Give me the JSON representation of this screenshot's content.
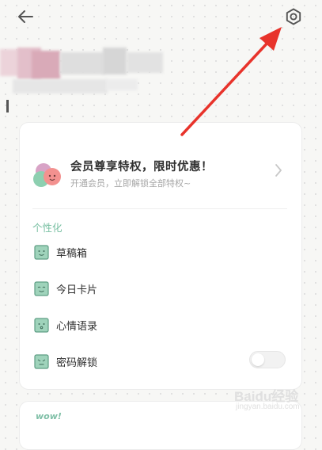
{
  "colors": {
    "accent": "#78bfa2",
    "annotation_arrow": "#e8332b",
    "icon_fill": "#9fd3bb",
    "icon_stroke": "#5e9e84"
  },
  "header": {
    "back_icon": "arrow-left-icon",
    "settings_icon": "gear-icon"
  },
  "membership": {
    "title": "会员尊享特权，限时优惠！",
    "subtitle": "开通会员，立即解锁全部特权~",
    "chevron_icon": "chevron-right-icon"
  },
  "personalization": {
    "section_title": "个性化",
    "items": [
      {
        "label": "草稿箱",
        "icon": "face-icon"
      },
      {
        "label": "今日卡片",
        "icon": "face-icon"
      },
      {
        "label": "心情语录",
        "icon": "face-icon"
      },
      {
        "label": "密码解锁",
        "icon": "face-icon",
        "toggle": false
      }
    ]
  },
  "next_card": {
    "label": "wow!"
  },
  "watermark": {
    "main": "Baidu经验",
    "sub": "jingyan.baidu.com"
  }
}
